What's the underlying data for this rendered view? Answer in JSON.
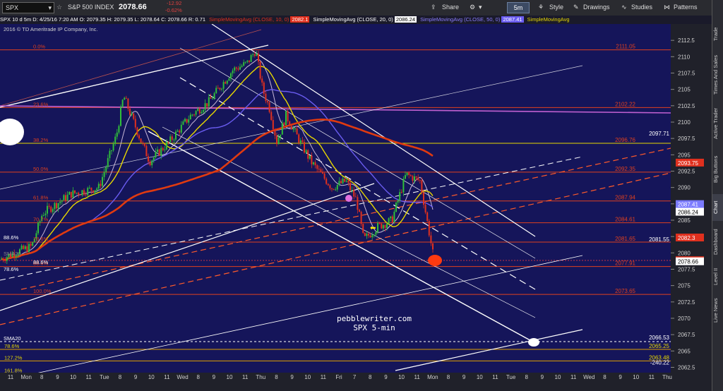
{
  "toolbar": {
    "symbol": "SPX",
    "description": "S&P 500 INDEX",
    "last": "2078.66",
    "change": "-12.92",
    "change_pct": "-0.62%",
    "timeframe": "5m",
    "buttons": [
      "Share",
      "Style",
      "Drawings",
      "Studies",
      "Patterns"
    ]
  },
  "legend": {
    "info": "SPX 10 d 5m D: 4/25/16 7:20 AM O: 2079.35 H: 2079.35 L: 2078.64 C: 2078.66 R: 0.71",
    "sma10_label": "SimpleMovingAvg (CLOSE, 10, 0)",
    "sma10_value": "2082.1",
    "sma20_label": "SimpleMovingAvg (CLOSE, 20, 0)",
    "sma20_value": "2086.24",
    "sma50_label": "SimpleMovingAvg (CLOSE, 50, 0)",
    "sma50_value": "2087.41",
    "sma_trunc": "SimpleMovingAvg",
    "copyright": "2016 © TD Ameritrade IP Company, Inc."
  },
  "sidebar": [
    "Trade",
    "Times And Sales",
    "Active Trader",
    "Big Buttons",
    "Chart",
    "Dashboard",
    "Level II",
    "Live News"
  ],
  "watermark": [
    "pebblewriter.com",
    "SPX 5-min"
  ],
  "chart_data": {
    "type": "candlestick",
    "ylim": [
      2060.5,
      2115
    ],
    "ylabels": [
      "2112.5",
      "2110",
      "2107.5",
      "2105",
      "2102.5",
      "2100",
      "2097.5",
      "2095",
      "2092.5",
      "2090",
      "2087.5",
      "2085",
      "2082.5",
      "2080",
      "2077.5",
      "2075",
      "2072.5",
      "2070",
      "2067.5",
      "2065",
      "2062.5"
    ],
    "yticks": [
      2112.5,
      2110,
      2107.5,
      2105,
      2102.5,
      2100,
      2097.5,
      2095,
      2092.5,
      2090,
      2087.5,
      2085,
      2082.5,
      2080,
      2077.5,
      2075,
      2072.5,
      2070,
      2067.5,
      2065,
      2062.5
    ],
    "xlabels": [
      "11",
      "Mon",
      "8",
      "9",
      "10",
      "11",
      "Tue",
      "8",
      "9",
      "10",
      "11",
      "Wed",
      "8",
      "9",
      "10",
      "11",
      "Thu",
      "8",
      "9",
      "10",
      "11",
      "Fri",
      "7",
      "8",
      "9",
      "10",
      "11",
      "Mon",
      "8",
      "9",
      "10",
      "11",
      "Tue",
      "8",
      "9",
      "10",
      "11",
      "Wed",
      "8",
      "9",
      "10",
      "11",
      "Thu"
    ],
    "fib_levels": [
      {
        "pct": "0.0%",
        "price": "2111.05",
        "value": 2111.05
      },
      {
        "pct": "23.6%",
        "price": "2102.22",
        "value": 2102.22
      },
      {
        "pct": "38.2%",
        "price": "2096.76",
        "value": 2096.76
      },
      {
        "pct": "50.0%",
        "price": "2092.35",
        "value": 2092.35
      },
      {
        "pct": "61.8%",
        "price": "2087.94",
        "value": 2087.94
      },
      {
        "pct": "70.7%",
        "price": "2084.61",
        "value": 2084.61
      },
      {
        "pct": "78.6%",
        "price": "2081.65",
        "value": 2081.65
      },
      {
        "pct": "88.6%",
        "price": "2077.91",
        "value": 2077.91
      },
      {
        "pct": "100.0%",
        "price": "2073.65",
        "value": 2073.65
      }
    ],
    "fib_lower": [
      {
        "pct": "78.6%",
        "price": "2065.25",
        "value": 2065.25
      },
      {
        "pct": "127.2%",
        "price": "2063.48",
        "value": 2063.48
      },
      {
        "pct": "161.8%",
        "price": "",
        "value": 2061.5
      }
    ],
    "side_labels": [
      "88.6%",
      "SMA20",
      "88.6%",
      "78.6%",
      "SMA20"
    ],
    "right_labels": [
      {
        "text": "2097.71",
        "value": 2097.71
      },
      {
        "text": "2081.55",
        "value": 2081.55
      },
      {
        "text": "2066.53",
        "value": 2066.53
      },
      {
        "text": "-240.22",
        "value": 2062.7
      }
    ],
    "price_tags": [
      {
        "text": "2093.75",
        "value": 2093.75,
        "color": "#e0301e"
      },
      {
        "text": "2087.41",
        "value": 2087.41,
        "color": "#7b7bff"
      },
      {
        "text": "2086.24",
        "value": 2086.24,
        "color": "#ffffff"
      },
      {
        "text": "2082.3",
        "value": 2082.3,
        "color": "#e0301e"
      },
      {
        "text": "2078.83",
        "value": 2078.83,
        "color": "#e0301e"
      },
      {
        "text": "2078.66",
        "value": 2078.66,
        "color": "#ffffff"
      }
    ],
    "colors": {
      "background": "#15155a",
      "up": "#2fbf3a",
      "down": "#e0301e",
      "sma10": "#c8b8d8",
      "sma20": "#e8d800",
      "sma50": "#6a5cf0",
      "sma200": "#e03a10",
      "magenta": "#d060d0"
    }
  }
}
